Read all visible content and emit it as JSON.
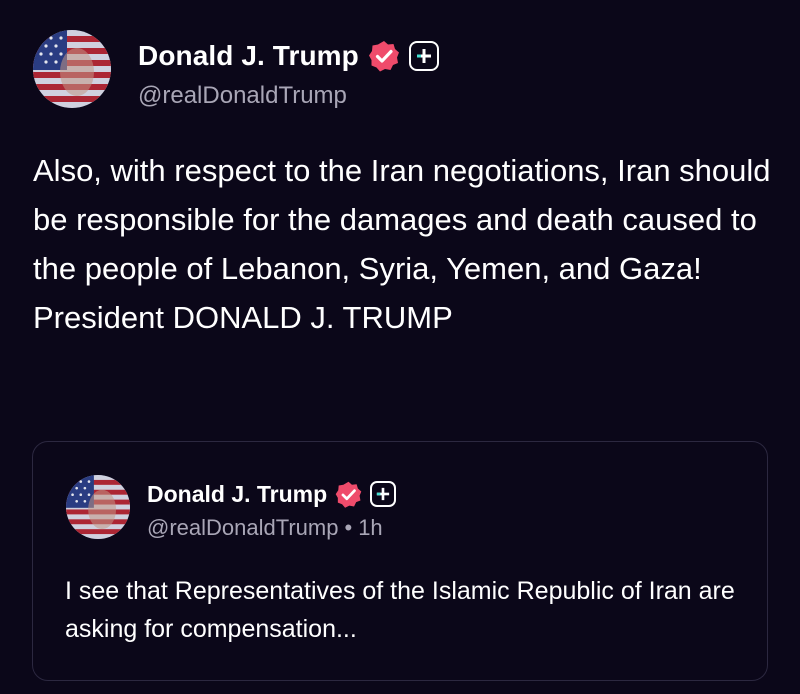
{
  "post": {
    "author_name": "Donald J. Trump",
    "handle": "@realDonaldTrump",
    "text": "Also, with respect to the Iran negotiations, Iran should be responsible for the damages and death caused to the people of Lebanon, Syria, Yemen, and Gaza! President DONALD J. TRUMP"
  },
  "quoted_post": {
    "author_name": "Donald J. Trump",
    "handle": "@realDonaldTrump",
    "separator": "•",
    "time": "1h",
    "text": "I see that Representatives of the Islamic Republic of Iran are asking for compensation..."
  },
  "icons": {
    "verified": "verified-badge-icon",
    "plus": "plus-badge-icon"
  },
  "colors": {
    "background": "#0b0719",
    "verified": "#ef4b6b",
    "muted": "#a9a6b6",
    "card_border": "#2c2840"
  }
}
